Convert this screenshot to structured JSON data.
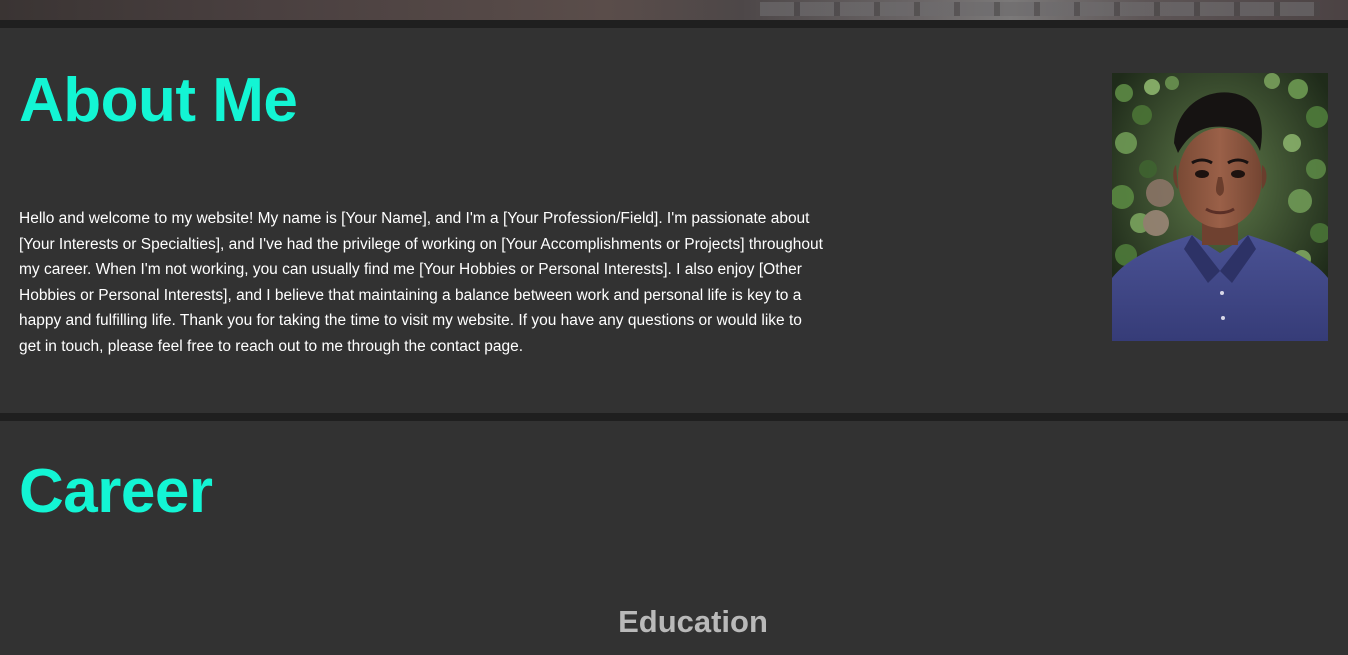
{
  "about": {
    "heading": "About Me",
    "paragraph": "Hello and welcome to my website! My name is [Your Name], and I'm a [Your Profession/Field]. I'm passionate about [Your Interests or Specialties], and I've had the privilege of working on [Your Accomplishments or Projects] throughout my career. When I'm not working, you can usually find me [Your Hobbies or Personal Interests]. I also enjoy [Other Hobbies or Personal Interests], and I believe that maintaining a balance between work and personal life is key to a happy and fulfilling life. Thank you for taking the time to visit my website. If you have any questions or would like to get in touch, please feel free to reach out to me through the contact page.",
    "photo_icon": "profile-photo"
  },
  "career": {
    "heading": "Career",
    "education_heading": "Education"
  },
  "colors": {
    "background": "#323232",
    "accent": "#13f5d4",
    "divider": "#1f1f1f",
    "body_text": "#ffffff",
    "subheading_text": "#b9b9b9"
  }
}
